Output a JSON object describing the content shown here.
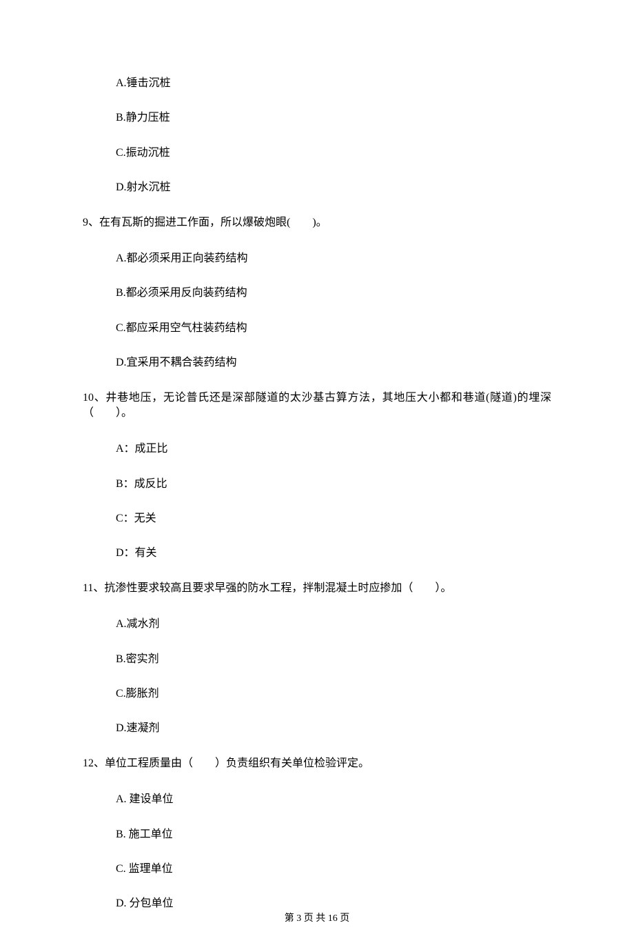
{
  "options_pre": [
    "A.锤击沉桩",
    "B.静力压桩",
    "C.振动沉桩",
    "D.射水沉桩"
  ],
  "q9": {
    "text": "9、在有瓦斯的掘进工作面，所以爆破炮眼(　　)。",
    "options": [
      "A.都必须采用正向装药结构",
      "B.都必须采用反向装药结构",
      "C.都应采用空气柱装药结构",
      "D.宜采用不耦合装药结构"
    ]
  },
  "q10": {
    "text": "10、井巷地压，无论普氏还是深部隧道的太沙基古算方法，其地压大小都和巷道(隧道)的埋深（　　）。",
    "options": [
      "A：成正比",
      "B：成反比",
      "C：无关",
      "D：有关"
    ]
  },
  "q11": {
    "text": "11、抗渗性要求较高且要求早强的防水工程，拌制混凝土时应掺加（　　）。",
    "options": [
      "A.减水剂",
      "B.密实剂",
      "C.膨胀剂",
      "D.速凝剂"
    ]
  },
  "q12": {
    "text": "12、单位工程质量由（　　）负责组织有关单位检验评定。",
    "options": [
      "A.  建设单位",
      "B.  施工单位",
      "C.  监理单位",
      "D.  分包单位"
    ]
  },
  "footer": "第 3 页 共 16 页"
}
